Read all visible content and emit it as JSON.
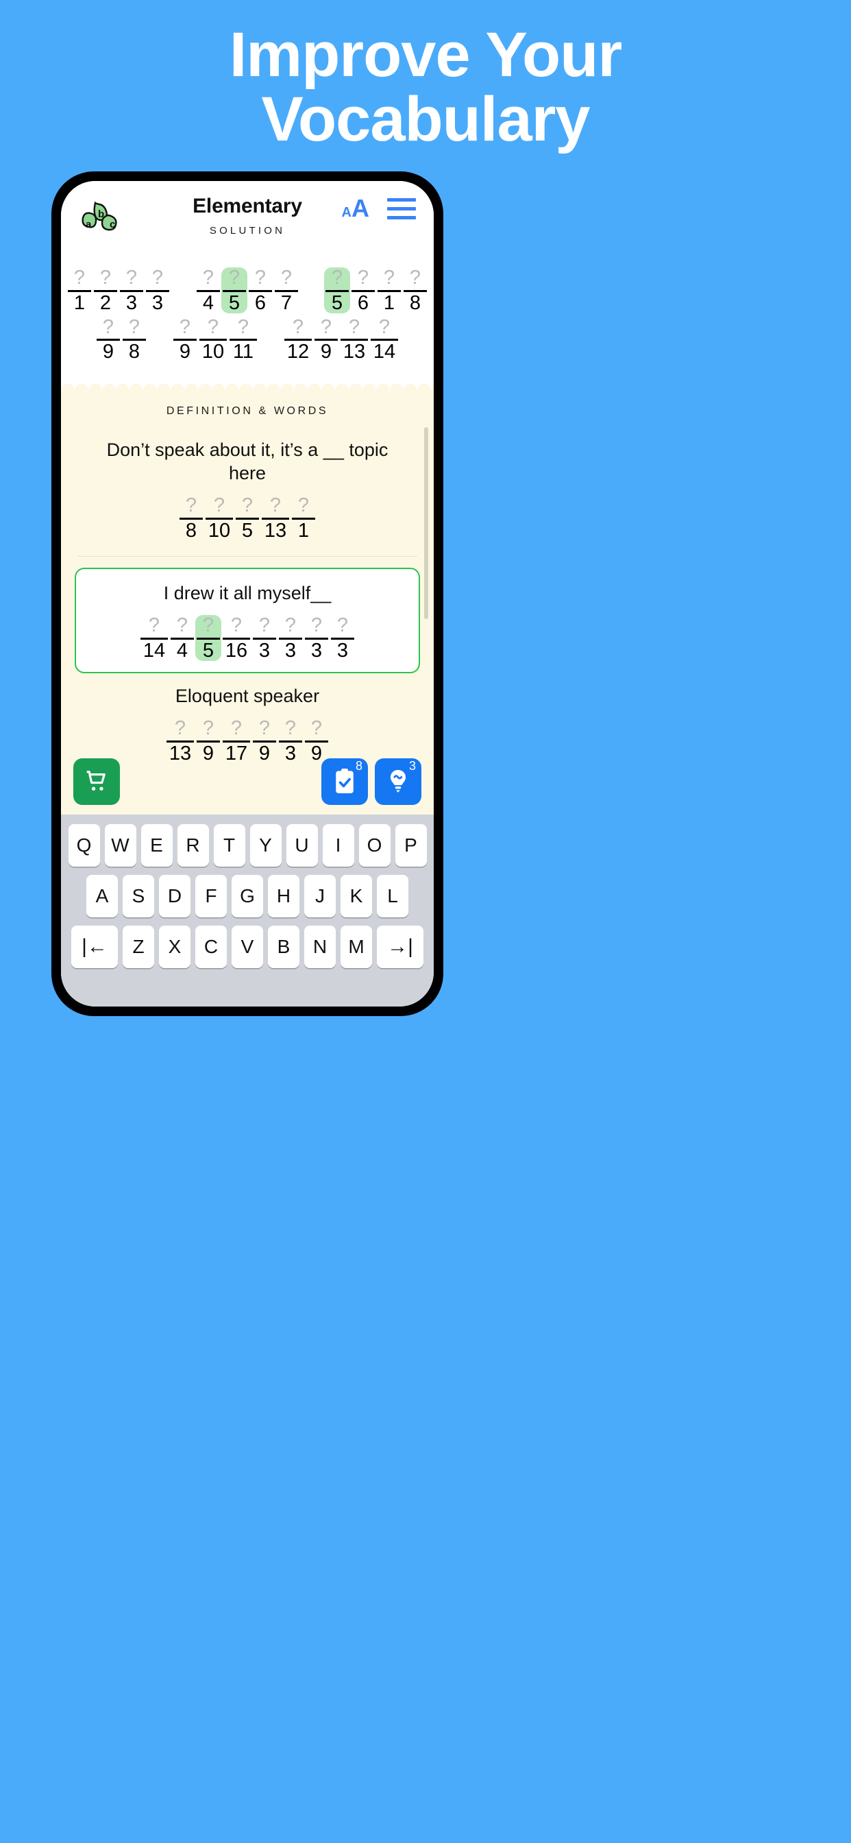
{
  "promo": {
    "line1": "Improve Your",
    "line2": "Vocabulary",
    "background_color": "#4aabfb",
    "text_color": "#ffffff"
  },
  "app": {
    "logo_name": "abc-logo",
    "header": {
      "title": "Elementary",
      "subtitle": "SOLUTION",
      "font_size_small": "A",
      "font_size_big": "A",
      "menu_icon": "hamburger-icon"
    },
    "solution": {
      "row1": [
        {
          "numbers": [
            "1",
            "2",
            "3",
            "3"
          ],
          "highlight_index": -1
        },
        {
          "numbers": [
            "4",
            "5",
            "6",
            "7"
          ],
          "highlight_index": 1
        },
        {
          "numbers": [
            "5",
            "6",
            "1",
            "8"
          ],
          "highlight_index": 0
        }
      ],
      "row2": [
        {
          "numbers": [
            "9",
            "8"
          ],
          "highlight_index": -1
        },
        {
          "numbers": [
            "9",
            "10",
            "11"
          ],
          "highlight_index": -1
        },
        {
          "numbers": [
            "12",
            "9",
            "13",
            "14"
          ],
          "highlight_index": -1
        }
      ],
      "placeholder": "?",
      "highlight_color": "#b5e7b8"
    },
    "panel": {
      "heading": "DEFINITION & WORDS",
      "background_color": "#fdf8e3",
      "clues": [
        {
          "text": "Don’t speak about it, it’s a __ topic here",
          "numbers": [
            "8",
            "10",
            "5",
            "13",
            "1"
          ],
          "highlight_index": -1,
          "selected": false
        },
        {
          "text": "I drew it all myself__",
          "numbers": [
            "14",
            "4",
            "5",
            "16",
            "3",
            "3",
            "3",
            "3"
          ],
          "highlight_index": 2,
          "selected": true,
          "border_color": "#2bc44c"
        },
        {
          "text": "Eloquent speaker",
          "numbers": [
            "13",
            "9",
            "17",
            "9",
            "3",
            "9"
          ],
          "highlight_index": -1,
          "selected": false
        }
      ]
    },
    "actions": {
      "shop": {
        "icon": "shopping-cart-icon",
        "color": "#1a9e54"
      },
      "check": {
        "icon": "clipboard-check-icon",
        "badge": "8",
        "color": "#1677f2"
      },
      "hint": {
        "icon": "lightbulb-icon",
        "badge": "3",
        "color": "#1677f2"
      }
    },
    "keyboard": {
      "row1": [
        "Q",
        "W",
        "E",
        "R",
        "T",
        "Y",
        "U",
        "I",
        "O",
        "P"
      ],
      "row2": [
        "A",
        "S",
        "D",
        "F",
        "G",
        "H",
        "J",
        "K",
        "L"
      ],
      "row3": [
        "⇤",
        "Z",
        "X",
        "C",
        "V",
        "B",
        "N",
        "M",
        "⇥"
      ],
      "prev_key_label": "|←",
      "next_key_label": "→|"
    }
  }
}
